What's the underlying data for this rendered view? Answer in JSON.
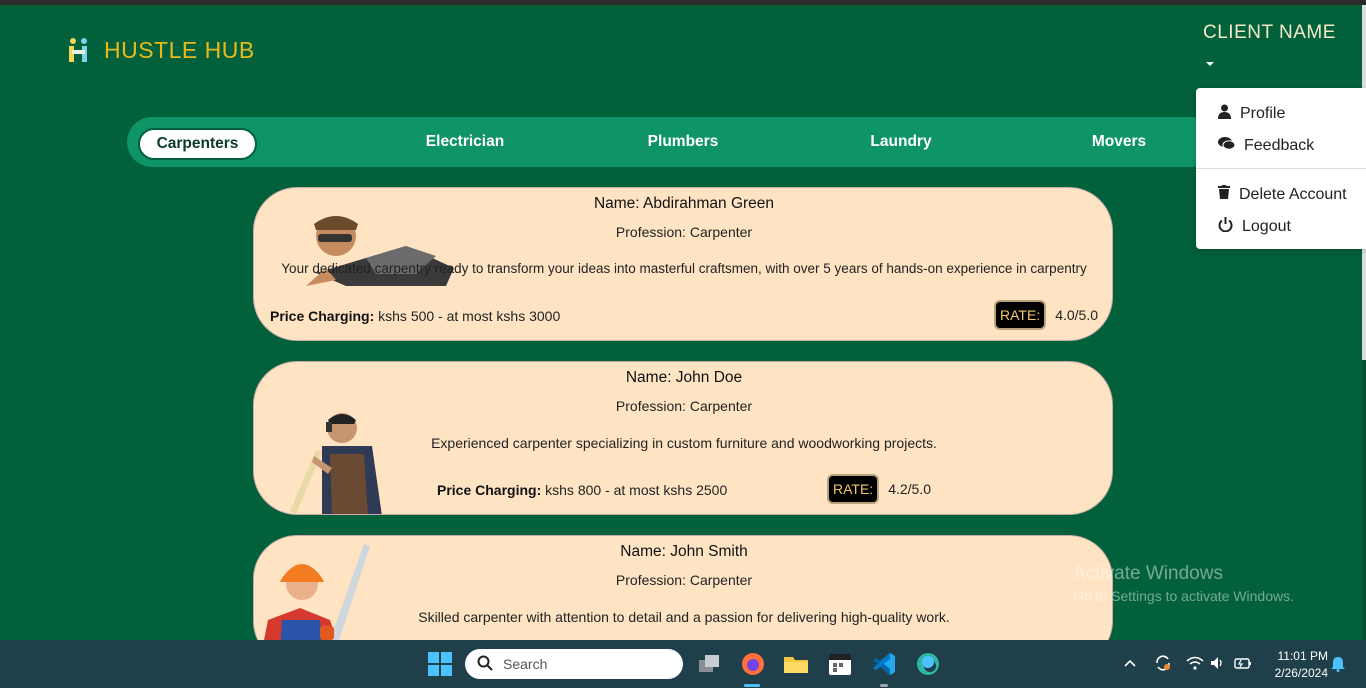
{
  "brand": {
    "name": "HUSTLE HUB",
    "icon": "people-icon"
  },
  "client": {
    "name": "CLIENT NAME"
  },
  "tabs": [
    "Carpenters",
    "Electrician",
    "Plumbers",
    "Laundry",
    "Movers"
  ],
  "dropdown": {
    "profile": "Profile",
    "feedback": "Feedback",
    "delete": "Delete Account",
    "logout": "Logout"
  },
  "cards": [
    {
      "name": "Name: Abdirahman Green",
      "profession": "Profession: Carpenter",
      "description": "Your dedicated carpentry ready to transform your ideas into masterful craftsmen, with over 5 years of hands-on experience in carpentry",
      "price_label": "Price Charging:",
      "price": "kshs 500 - at most kshs 3000",
      "rate_label": "RATE:",
      "rate": "4.0/5.0"
    },
    {
      "name": "Name: John Doe",
      "profession": "Profession: Carpenter",
      "description": "Experienced carpenter specializing in custom furniture and woodworking projects.",
      "price_label": "Price Charging:",
      "price": "kshs 800 - at most kshs 2500",
      "rate_label": "RATE:",
      "rate": "4.2/5.0"
    },
    {
      "name": "Name: John Smith",
      "profession": "Profession: Carpenter",
      "description": "Skilled carpenter with attention to detail and a passion for delivering high-quality work."
    }
  ],
  "watermark": {
    "title": "Activate Windows",
    "subtitle": "Go to Settings to activate Windows."
  },
  "taskbar": {
    "search_placeholder": "Search",
    "time": "11:01 PM",
    "date": "2/26/2024"
  },
  "colors": {
    "background": "#02613a",
    "tab_bar": "#0f9467",
    "brand": "#e8b91e",
    "card": "#ffe4c4"
  }
}
